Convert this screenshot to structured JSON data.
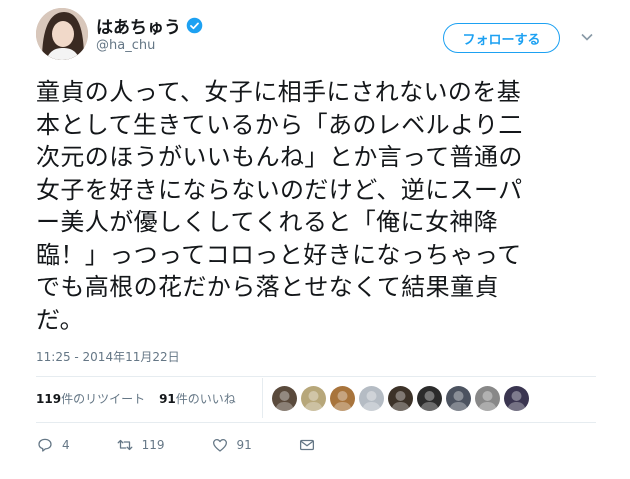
{
  "user": {
    "display_name": "はあちゅう",
    "handle": "@ha_chu",
    "verified_icon": "verified-badge-icon",
    "avatar_icon": "avatar"
  },
  "follow_button": {
    "label": "フォローする"
  },
  "tweet": {
    "text": "童貞の人って、女子に相手にされないのを基\n本として生きているから「あのレベルより二\n次元のほうがいいもんね」とか言って普通の\n女子を好きにならないのだけど、逆にスーパ\nー美人が優しくしてくれると「俺に女神降\n臨！」っつってコロっと好きになっちゃって\nでも高根の花だから落とせなくて結果童貞\nだ。",
    "timestamp": "11:25 - 2014年11月22日"
  },
  "stats": {
    "retweets_count": "119",
    "retweets_label": "件のリツイート",
    "likes_count": "91",
    "likes_label": "件のいいね"
  },
  "likers": [
    {
      "color": "#5a4a3c"
    },
    {
      "color": "#b7a77a"
    },
    {
      "color": "#a8743c"
    },
    {
      "color": "#b5bcc4"
    },
    {
      "color": "#3c3228"
    },
    {
      "color": "#2b2b2b"
    },
    {
      "color": "#4c5360"
    },
    {
      "color": "#888888"
    },
    {
      "color": "#3a3550"
    }
  ],
  "actions": {
    "reply_count": "4",
    "retweet_count": "119",
    "like_count": "91"
  },
  "colors": {
    "accent": "#1da1f2",
    "muted": "#657786"
  }
}
